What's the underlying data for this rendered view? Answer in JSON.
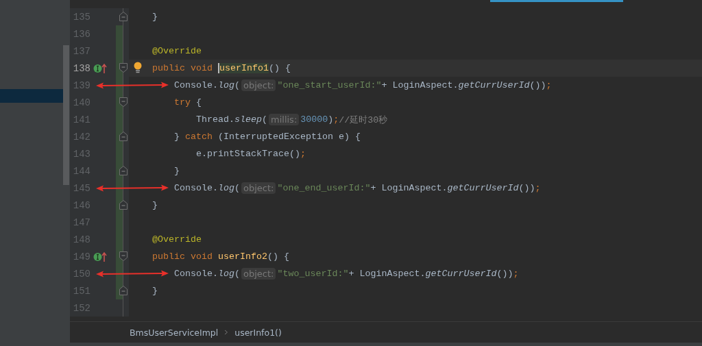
{
  "editor": {
    "lines": [
      {
        "number": "135",
        "fold_end": true,
        "tokens": [
          {
            "kind": "plain",
            "text": "}"
          }
        ]
      },
      {
        "number": "136",
        "changed": true
      },
      {
        "number": "137",
        "changed": true,
        "tokens": [
          {
            "kind": "annotation",
            "text": "@Override"
          }
        ]
      },
      {
        "number": "138",
        "changed": true,
        "current": true,
        "bulb": true,
        "overrides": true,
        "fold_start": true,
        "tokens": [
          {
            "kind": "keyword",
            "text": "public void "
          },
          {
            "kind": "decl",
            "text": "userInfo1",
            "caret": true
          },
          {
            "kind": "plain",
            "text": "() {"
          }
        ],
        "children": [
          {
            "number": "139",
            "changed": true,
            "arrow": true,
            "tokens": [
              {
                "kind": "plain",
                "text": "Console."
              },
              {
                "kind": "static",
                "text": "log"
              },
              {
                "kind": "plain",
                "text": "("
              },
              {
                "kind": "hint",
                "text": "object:"
              },
              {
                "kind": "string",
                "text": "\"one_start_userId:\""
              },
              {
                "kind": "plain",
                "text": "+ LoginAspect."
              },
              {
                "kind": "static",
                "text": "getCurrUserId"
              },
              {
                "kind": "plain",
                "text": "())"
              },
              {
                "kind": "semi",
                "text": ";"
              }
            ]
          },
          {
            "number": "140",
            "changed": true,
            "fold_start": true,
            "tokens": [
              {
                "kind": "keyword",
                "text": "try"
              },
              {
                "kind": "plain",
                "text": " {"
              }
            ],
            "children": [
              {
                "number": "141",
                "changed": true,
                "tokens": [
                  {
                    "kind": "plain",
                    "text": "Thread."
                  },
                  {
                    "kind": "static",
                    "text": "sleep"
                  },
                  {
                    "kind": "plain",
                    "text": "("
                  },
                  {
                    "kind": "hint",
                    "text": "millis:"
                  },
                  {
                    "kind": "number",
                    "text": "30000"
                  },
                  {
                    "kind": "plain",
                    "text": ")"
                  },
                  {
                    "kind": "semi",
                    "text": ";"
                  },
                  {
                    "kind": "comment",
                    "text": "//延时30秒"
                  }
                ]
              }
            ]
          },
          {
            "number": "142",
            "changed": true,
            "fold_end": true,
            "tokens": [
              {
                "kind": "plain",
                "text": "} "
              },
              {
                "kind": "keyword",
                "text": "catch"
              },
              {
                "kind": "plain",
                "text": " (InterruptedException e) {"
              }
            ],
            "children": [
              {
                "number": "143",
                "changed": true,
                "tokens": [
                  {
                    "kind": "plain",
                    "text": "e.printStackTrace()"
                  },
                  {
                    "kind": "semi",
                    "text": ";"
                  }
                ]
              }
            ]
          },
          {
            "number": "144",
            "changed": true,
            "fold_end": true,
            "tokens": [
              {
                "kind": "plain",
                "text": "}"
              }
            ]
          },
          {
            "number": "145",
            "changed": true,
            "arrow": true,
            "tokens": [
              {
                "kind": "plain",
                "text": "Console."
              },
              {
                "kind": "static",
                "text": "log"
              },
              {
                "kind": "plain",
                "text": "("
              },
              {
                "kind": "hint",
                "text": "object:"
              },
              {
                "kind": "string",
                "text": "\"one_end_userId:\""
              },
              {
                "kind": "plain",
                "text": "+ LoginAspect."
              },
              {
                "kind": "static",
                "text": "getCurrUserId"
              },
              {
                "kind": "plain",
                "text": "())"
              },
              {
                "kind": "semi",
                "text": ";"
              }
            ]
          }
        ]
      },
      {
        "number": "146",
        "changed": true,
        "fold_end": true,
        "tokens": [
          {
            "kind": "plain",
            "text": "}"
          }
        ]
      },
      {
        "number": "147",
        "changed": true
      },
      {
        "number": "148",
        "changed": true,
        "tokens": [
          {
            "kind": "annotation",
            "text": "@Override"
          }
        ]
      },
      {
        "number": "149",
        "changed": true,
        "overrides": true,
        "fold_start": true,
        "tokens": [
          {
            "kind": "keyword",
            "text": "public void "
          },
          {
            "kind": "decl",
            "text": "userInfo2"
          },
          {
            "kind": "plain",
            "text": "() {"
          }
        ],
        "children": [
          {
            "number": "150",
            "changed": true,
            "arrow": true,
            "tokens": [
              {
                "kind": "plain",
                "text": "Console."
              },
              {
                "kind": "static",
                "text": "log"
              },
              {
                "kind": "plain",
                "text": "("
              },
              {
                "kind": "hint",
                "text": "object:"
              },
              {
                "kind": "string",
                "text": "\"two_userId:\""
              },
              {
                "kind": "plain",
                "text": "+ LoginAspect."
              },
              {
                "kind": "static",
                "text": "getCurrUserId"
              },
              {
                "kind": "plain",
                "text": "())"
              },
              {
                "kind": "semi",
                "text": ";"
              }
            ]
          }
        ]
      },
      {
        "number": "151",
        "changed": true,
        "fold_end": true,
        "tokens": [
          {
            "kind": "plain",
            "text": "}"
          }
        ]
      },
      {
        "number": "152"
      }
    ]
  },
  "breadcrumbs": [
    "BmsUserServiceImpl",
    "userInfo1()"
  ]
}
